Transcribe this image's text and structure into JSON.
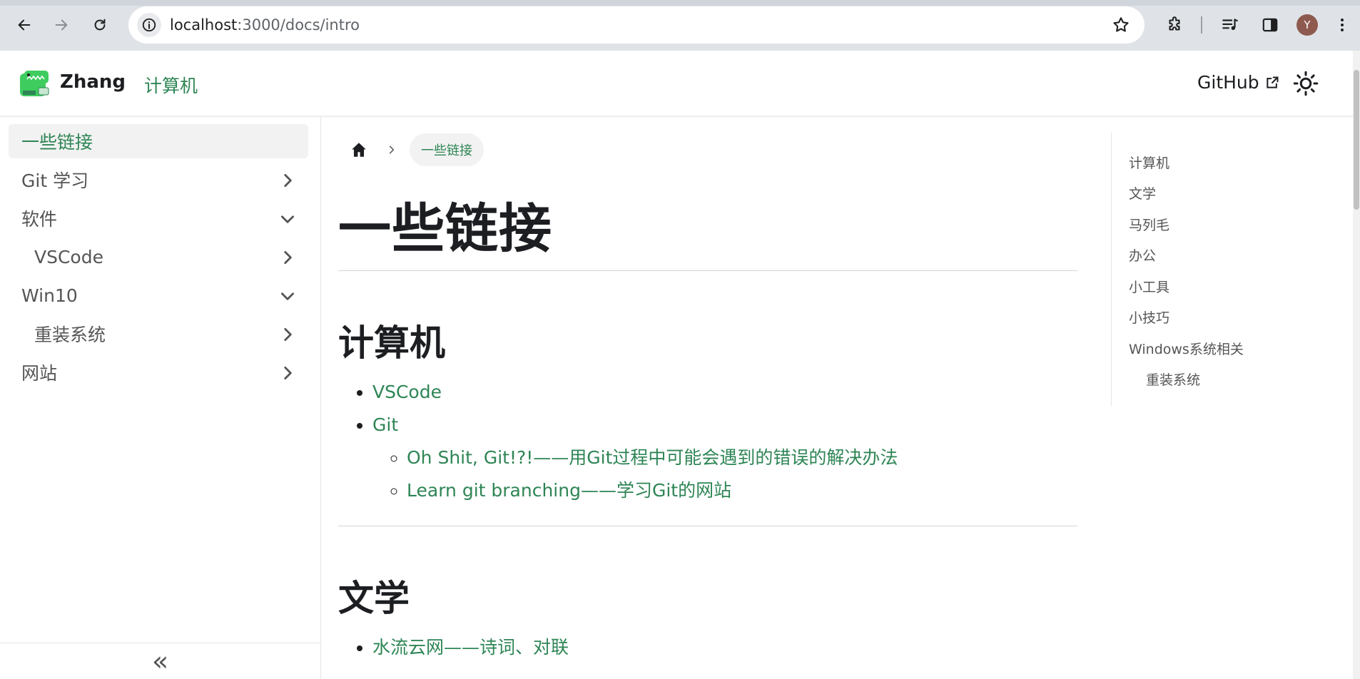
{
  "browser": {
    "url_host": "localhost",
    "url_path": ":3000/docs/intro",
    "profile_initial": "Y"
  },
  "navbar": {
    "brand": "Zhang",
    "nav_link": "计算机",
    "github_label": "GitHub"
  },
  "sidebar": {
    "items": [
      {
        "label": "一些链接",
        "active": true,
        "level": 0,
        "chevron": "none"
      },
      {
        "label": "Git 学习",
        "active": false,
        "level": 0,
        "chevron": "right"
      },
      {
        "label": "软件",
        "active": false,
        "level": 0,
        "chevron": "down"
      },
      {
        "label": "VSCode",
        "active": false,
        "level": 1,
        "chevron": "right"
      },
      {
        "label": "Win10",
        "active": false,
        "level": 0,
        "chevron": "down"
      },
      {
        "label": "重装系统",
        "active": false,
        "level": 1,
        "chevron": "right"
      },
      {
        "label": "网站",
        "active": false,
        "level": 0,
        "chevron": "right"
      }
    ],
    "collapse_label": "«"
  },
  "breadcrumb": {
    "current": "一些链接"
  },
  "main": {
    "title": "一些链接",
    "sections": [
      {
        "heading": "计算机",
        "links": [
          {
            "label": "VSCode"
          },
          {
            "label": "Git",
            "children": [
              {
                "label": "Oh Shit, Git!?!——用Git过程中可能会遇到的错误的解决办法"
              },
              {
                "label": "Learn git branching——学习Git的网站"
              }
            ]
          }
        ]
      },
      {
        "heading": "文学",
        "links": [
          {
            "label": "水流云网——诗词、对联"
          }
        ]
      }
    ]
  },
  "toc": {
    "items": [
      {
        "label": "计算机"
      },
      {
        "label": "文学"
      },
      {
        "label": "马列毛"
      },
      {
        "label": "办公"
      },
      {
        "label": "小工具"
      },
      {
        "label": "小技巧"
      },
      {
        "label": "Windows系统相关"
      },
      {
        "label": "重装系统"
      }
    ]
  },
  "colors": {
    "accent": "#2e8555",
    "text": "#1c1e21",
    "muted": "#555555"
  }
}
